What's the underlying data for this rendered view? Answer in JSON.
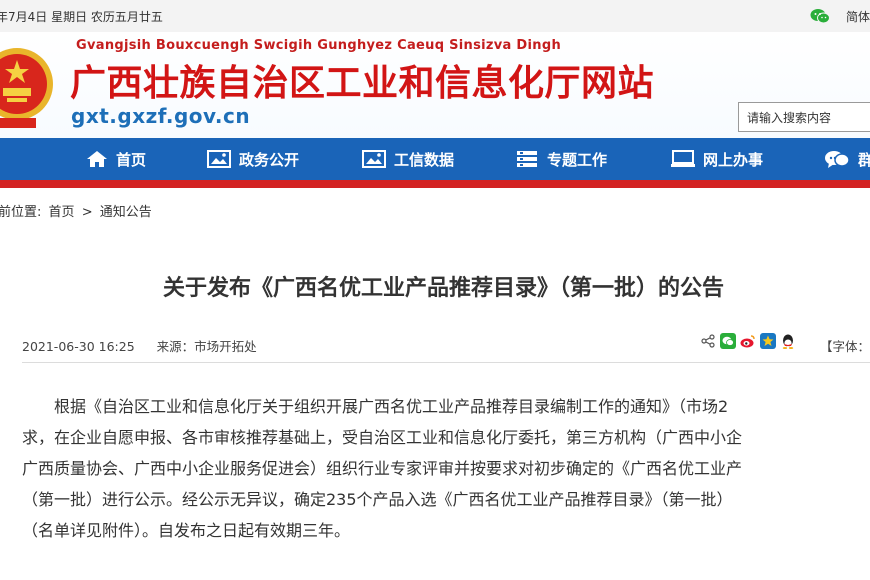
{
  "topbar": {
    "date": "年7月4日  星期日  农历五月廿五",
    "wechat_icon": "wechat-icon",
    "lang": "简体"
  },
  "header": {
    "zhuang_name": "Gvangjsih Bouxcuengh Swcigih Gunghyez Caeuq Sinsizva Dingh",
    "title": "广西壮族自治区工业和信息化厅网站",
    "domain": "gxt.gxzf.gov.cn",
    "emblem_icon": "national-emblem-icon"
  },
  "search": {
    "placeholder": "请输入搜索内容"
  },
  "nav": {
    "items": [
      {
        "label": "首页",
        "icon": "home-icon"
      },
      {
        "label": "政务公开",
        "icon": "image-icon"
      },
      {
        "label": "工信数据",
        "icon": "image-icon"
      },
      {
        "label": "专题工作",
        "icon": "list-icon"
      },
      {
        "label": "网上办事",
        "icon": "monitor-icon"
      },
      {
        "label": "群",
        "icon": "chat-icon"
      }
    ]
  },
  "breadcrumb": {
    "prefix": "前位置:",
    "home": "首页",
    "sep": ">",
    "current": "通知公告"
  },
  "article": {
    "title": "关于发布《广西名优工业产品推荐目录》（第一批）的公告",
    "date": "2021-06-30 16:25",
    "source": "来源：市场开拓处",
    "font_label": "【字体：大",
    "share_icons": [
      "share-icon",
      "wechat-icon",
      "weibo-icon",
      "qzone-icon",
      "qq-icon"
    ],
    "paragraph_lines": [
      "　　根据《自治区工业和信息化厅关于组织开展广西名优工业产品推荐目录编制工作的通知》（市场2",
      "求，在企业自愿申报、各市审核推荐基础上，受自治区工业和信息化厅委托，第三方机构（广西中小企",
      "广西质量协会、广西中小企业服务促进会）组织行业专家评审并按要求对初步确定的《广西名优工业产",
      "（第一批）进行公示。经公示无异议，确定235个产品入选《广西名优工业产品推荐目录》（第一批）",
      "（名单详见附件）。自发布之日起有效期三年。"
    ]
  },
  "colors": {
    "brand_red": "#d21515",
    "nav_blue": "#1a64b8",
    "domain_blue": "#1d6fb8"
  }
}
